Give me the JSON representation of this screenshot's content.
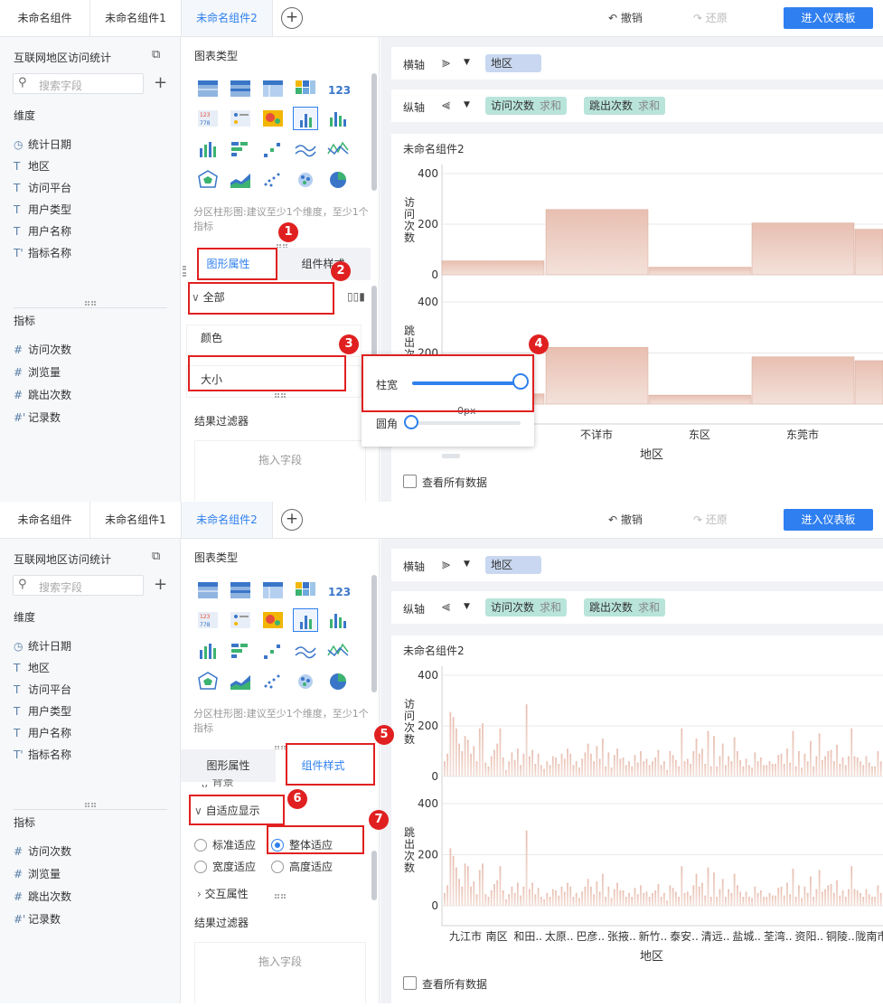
{
  "tabs": [
    "未命名组件",
    "未命名组件1",
    "未命名组件2"
  ],
  "add_tab": "+",
  "undo_label": "撤销",
  "redo_label": "还原",
  "dashboard_button": "进入仪表板",
  "left_panel": {
    "dataset": "互联网地区访问统计",
    "search_placeholder": "搜索字段",
    "dimension_title": "维度",
    "dimensions": [
      {
        "icon": "◷",
        "label": "统计日期"
      },
      {
        "icon": "T",
        "label": "地区"
      },
      {
        "icon": "T",
        "label": "访问平台"
      },
      {
        "icon": "T",
        "label": "用户类型"
      },
      {
        "icon": "T",
        "label": "用户名称"
      },
      {
        "icon": "T'",
        "label": "指标名称"
      }
    ],
    "metric_title": "指标",
    "metrics": [
      {
        "icon": "#",
        "label": "访问次数"
      },
      {
        "icon": "#",
        "label": "浏览量"
      },
      {
        "icon": "#",
        "label": "跳出次数"
      },
      {
        "icon": "#'",
        "label": "记录数"
      }
    ]
  },
  "middle_panel": {
    "chart_types_title": "图表类型",
    "hint": "分区柱形图:建议至少1个维度，至少1个指标",
    "prop_tabs": [
      "图形属性",
      "组件样式"
    ],
    "filter_title": "结果过滤器",
    "drop_hint": "拖入字段"
  },
  "panel1": {
    "all_label": "全部",
    "color_label": "颜色",
    "size_label": "大小",
    "popup": {
      "width_label": "柱宽",
      "width_value": 1.0,
      "radius_label": "圆角",
      "radius_value": 0,
      "radius_unit": "0px"
    }
  },
  "panel2": {
    "background_partial": "背景",
    "adaptive_label": "自适应显示",
    "options": [
      "标准适应",
      "整体适应",
      "宽度适应",
      "高度适应"
    ],
    "selected_option": "整体适应",
    "interaction_label": "交互属性"
  },
  "axes": {
    "x_label": "横轴",
    "x_field": "地区",
    "y_label": "纵轴",
    "y_fields": [
      {
        "name": "访问次数",
        "agg": "求和"
      },
      {
        "name": "跳出次数",
        "agg": "求和"
      }
    ]
  },
  "chart_title": "未命名组件2",
  "view_all_data": "查看所有数据",
  "markers": [
    "1",
    "2",
    "3",
    "4",
    "5",
    "6",
    "7"
  ],
  "colors": {
    "accent": "#2f80ed",
    "bar_top": "#e8bfb1",
    "bar_bottom": "#f3e1da",
    "marker": "#e02020"
  },
  "chart_data": [
    {
      "type": "bar",
      "title": "",
      "xlabel": "地区",
      "categories": [
        "",
        "不详市",
        "东区",
        "东莞市",
        ""
      ],
      "series": [
        {
          "name": "访问次数",
          "values": [
            55,
            258,
            30,
            205,
            180
          ]
        },
        {
          "name": "跳出次数",
          "values": [
            40,
            222,
            35,
            185,
            170
          ]
        }
      ],
      "ylim": [
        0,
        400
      ],
      "yticks": [
        0,
        200,
        400
      ],
      "y_axis_labels": [
        "访问次数",
        "跳出次数"
      ]
    },
    {
      "type": "bar",
      "title": "",
      "xlabel": "地区",
      "category_labels": [
        "九江市",
        "南区",
        "和田..",
        "太原..",
        "巴彦..",
        "张掖..",
        "新竹..",
        "泰安..",
        "清远..",
        "盐城..",
        "荃湾..",
        "资阳..",
        "铜陵..",
        "陇南市"
      ],
      "series": [
        {
          "name": "访问次数",
          "values": [
            60,
            90,
            255,
            235,
            190,
            130,
            100,
            160,
            145,
            90,
            120,
            60,
            190,
            210,
            55,
            40,
            80,
            105,
            130,
            190,
            75,
            25,
            60,
            95,
            65,
            110,
            45,
            90,
            285,
            80,
            105,
            50,
            90,
            45,
            30,
            60,
            45,
            80,
            75,
            50,
            90,
            70,
            110,
            90,
            45,
            60,
            35,
            70,
            95,
            130,
            90,
            60,
            120,
            70,
            150,
            40,
            95,
            35,
            85,
            110,
            70,
            75,
            45,
            60,
            40,
            85,
            55,
            100,
            60,
            70,
            45,
            60,
            75,
            105,
            45,
            60,
            25,
            100,
            85,
            65,
            40,
            190,
            60,
            70,
            50,
            100,
            150,
            90,
            110,
            50,
            180,
            40,
            160,
            40,
            80,
            130,
            45,
            80,
            60,
            155,
            100,
            65,
            40,
            70,
            45,
            35,
            95,
            60,
            75,
            45,
            45,
            60,
            50,
            50,
            85,
            90,
            50,
            110,
            55,
            180,
            40,
            100,
            35,
            90,
            60,
            140,
            40,
            80,
            170,
            65,
            80,
            100,
            105,
            60,
            125,
            50,
            75,
            45,
            80,
            190,
            80,
            75,
            60,
            45,
            80,
            55,
            40,
            40,
            100,
            60
          ]
        },
        {
          "name": "跳出次数",
          "values": [
            50,
            80,
            225,
            195,
            150,
            105,
            75,
            165,
            155,
            75,
            95,
            45,
            140,
            165,
            45,
            35,
            60,
            85,
            100,
            155,
            60,
            25,
            45,
            75,
            50,
            90,
            40,
            75,
            295,
            65,
            90,
            45,
            70,
            35,
            25,
            50,
            35,
            65,
            60,
            40,
            75,
            55,
            90,
            75,
            35,
            50,
            30,
            55,
            75,
            105,
            75,
            45,
            95,
            55,
            125,
            35,
            75,
            30,
            65,
            90,
            60,
            60,
            35,
            50,
            35,
            70,
            45,
            80,
            50,
            55,
            35,
            50,
            60,
            85,
            35,
            50,
            20,
            80,
            70,
            55,
            35,
            155,
            50,
            55,
            40,
            80,
            125,
            75,
            90,
            40,
            150,
            35,
            130,
            35,
            65,
            105,
            35,
            65,
            50,
            125,
            80,
            55,
            35,
            55,
            35,
            30,
            75,
            50,
            60,
            35,
            35,
            50,
            40,
            40,
            70,
            75,
            40,
            90,
            45,
            145,
            35,
            80,
            30,
            75,
            50,
            115,
            35,
            65,
            140,
            55,
            65,
            80,
            85,
            50,
            100,
            40,
            60,
            35,
            65,
            155,
            65,
            60,
            50,
            35,
            65,
            45,
            35,
            35,
            80,
            50
          ]
        }
      ],
      "ylim": [
        0,
        400
      ],
      "yticks": [
        0,
        200,
        400
      ],
      "y_axis_labels": [
        "访问次数",
        "跳出次数"
      ]
    }
  ]
}
